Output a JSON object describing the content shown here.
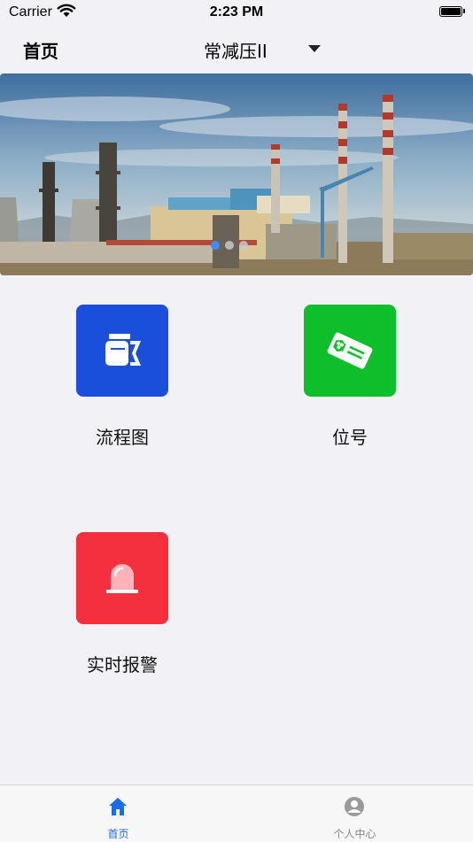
{
  "status_bar": {
    "carrier": "Carrier",
    "time": "2:23 PM"
  },
  "nav": {
    "title": "首页",
    "unit_selector": "常减压II",
    "selector_icon": "caret-down-icon"
  },
  "banner": {
    "alt": "refinery-photo",
    "page_count": 3,
    "active_page": 1
  },
  "tiles": [
    {
      "label": "流程图",
      "color": "#1a4fdc",
      "icon": "flowchart-icon"
    },
    {
      "label": "位号",
      "color": "#0dbf2a",
      "icon": "tag-icon"
    },
    {
      "label": "实时报警",
      "color": "#f4303f",
      "icon": "alarm-light-icon"
    }
  ],
  "tabbar": {
    "items": [
      {
        "label": "首页",
        "icon": "home-icon",
        "active": true,
        "color": "#1a6de8"
      },
      {
        "label": "个人中心",
        "icon": "user-icon",
        "active": false,
        "color": "#8a8a8a"
      }
    ]
  }
}
